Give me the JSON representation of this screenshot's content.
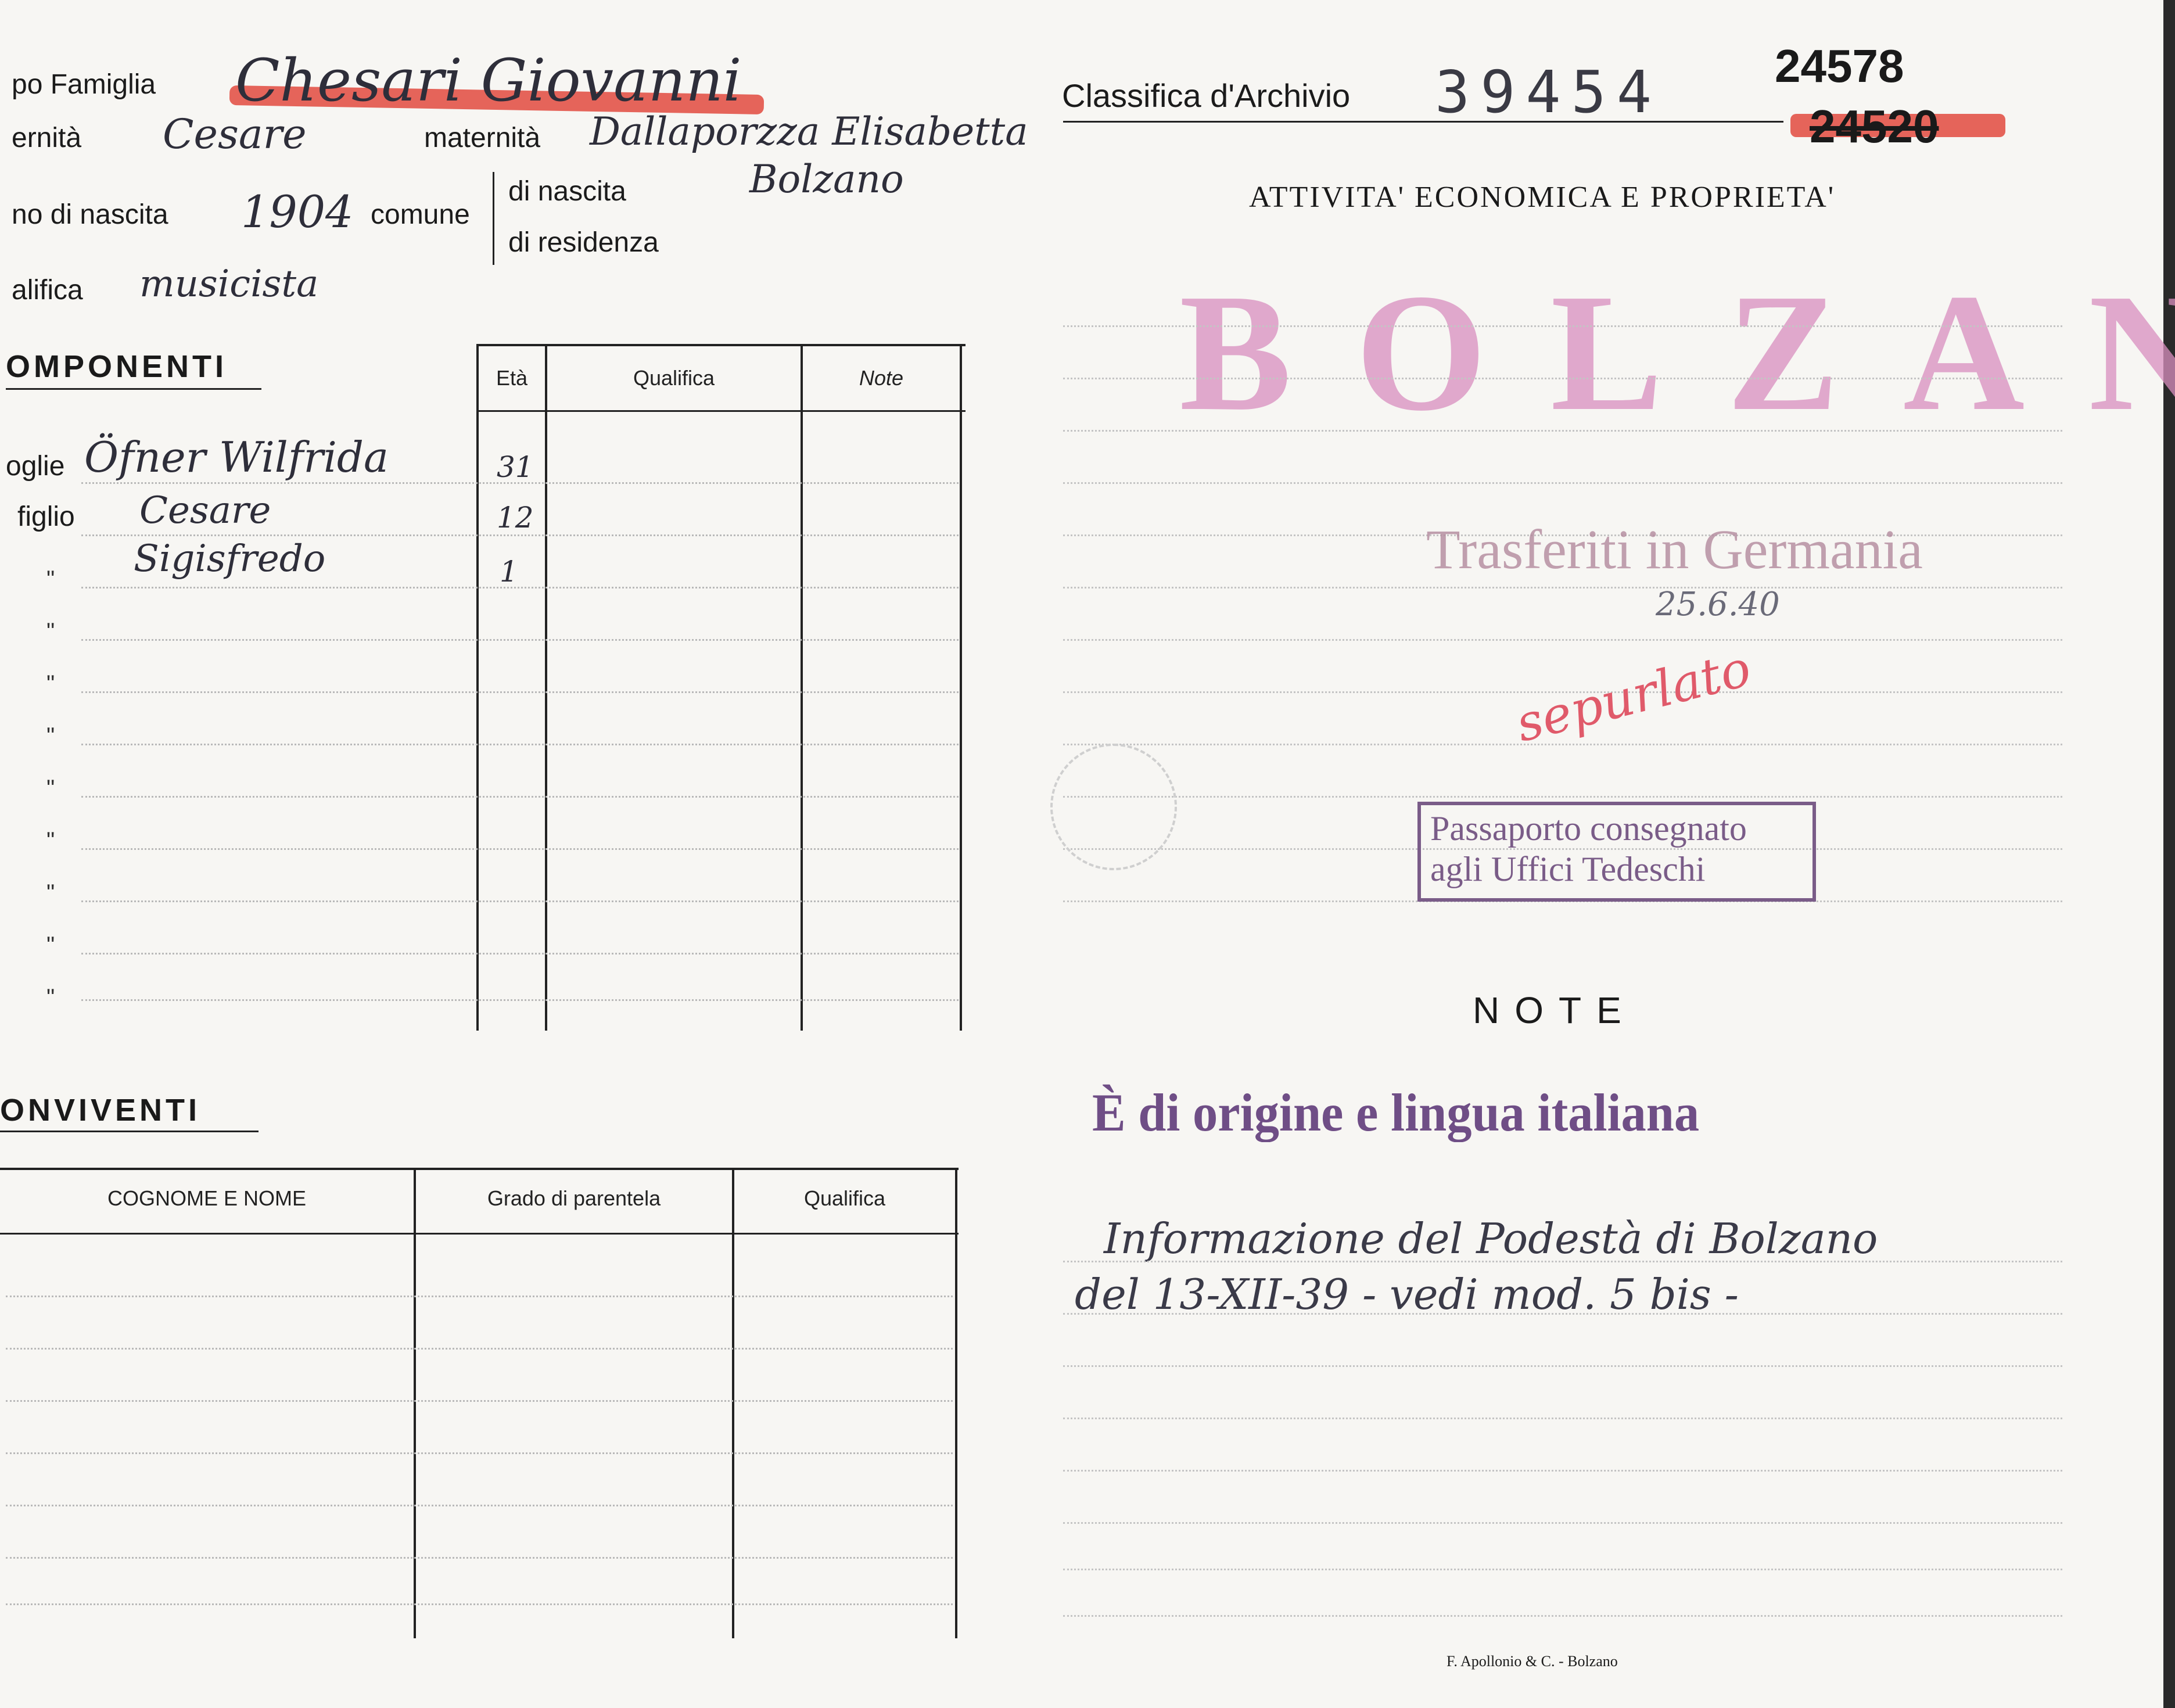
{
  "header": {
    "capo_famiglia_label": "po Famiglia",
    "capo_famiglia_value": "Chesari Giovanni",
    "paternita_label": "ernità",
    "paternita_value": "Cesare",
    "maternita_label": "maternità",
    "maternita_value": "Dallaporzza Elisabetta",
    "anno_nascita_label": "no di nascita",
    "anno_nascita_value": "1904",
    "comune_label": "comune",
    "di_nascita_label": "di nascita",
    "di_nascita_value": "Bolzano",
    "di_residenza_label": "di residenza",
    "qualifica_label": "alifica",
    "qualifica_value": "musicista"
  },
  "archive": {
    "classifica_label": "Classifica d'Archivio",
    "classifica_value": "39454",
    "number_top": "24578",
    "number_struck": "24520",
    "section_title": "ATTIVITA' ECONOMICA E PROPRIETA'",
    "city_stamp": "BOLZANO",
    "transfer_stamp": "Trasferiti in Germania",
    "transfer_date": "25.6.40",
    "handwritten_red": "sepurlato",
    "passport_stamp_line1": "Passaporto consegnato",
    "passport_stamp_line2": "agli Uffici Tedeschi"
  },
  "componenti": {
    "title": "OMPONENTI",
    "col_eta": "Età",
    "col_qualifica": "Qualifica",
    "col_note": "Note",
    "rows": [
      {
        "rel": "oglie",
        "name": "Öfner Wilfrida",
        "eta": "31"
      },
      {
        "rel": "figlio",
        "name": "Cesare",
        "eta": "12"
      },
      {
        "rel": "\"",
        "name": "Sigisfredo",
        "eta": "1"
      }
    ],
    "ditto": "\""
  },
  "conviventi": {
    "title": "ONVIVENTI",
    "col_nome": "COGNOME E NOME",
    "col_grado": "Grado di parentela",
    "col_qualifica": "Qualifica"
  },
  "note": {
    "title": "NOTE",
    "stamp": "È di origine e lingua italiana",
    "handwritten_line1": "Informazione del Podestà di Bolzano",
    "handwritten_line2": "del 13-XII-39 - vedi mod. 5 bis -"
  },
  "footer": {
    "printer": "F. Apollonio & C. - Bolzano"
  },
  "colors": {
    "paper": "#f7f6f3",
    "red_ink": "#d9463e",
    "stamp_purple": "#7a5c88",
    "stamp_pink": "#d98fbf"
  }
}
